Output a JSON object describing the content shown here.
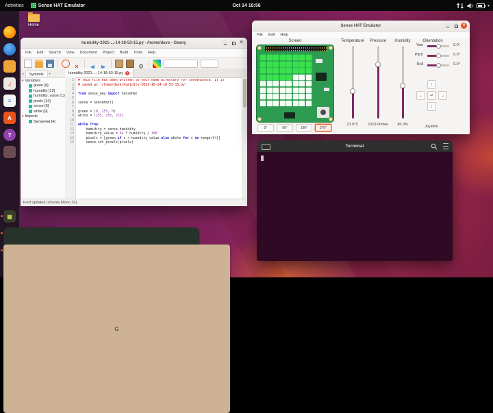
{
  "topbar": {
    "activities": "Activities",
    "focused_app": "Sense HAT Emulator",
    "clock": "Oct 14 18:56"
  },
  "desktop": {
    "home_label": "Home"
  },
  "dock": {
    "items": [
      {
        "id": "firefox",
        "color": ""
      },
      {
        "id": "thunderbird",
        "color": ""
      },
      {
        "id": "files",
        "color": "#f0a637"
      },
      {
        "id": "rhythmbox",
        "color": "#ece7e2",
        "glyph": "♫",
        "glyph_color": "#e9531f"
      },
      {
        "id": "libreoffice-writer",
        "color": "#f4f4f4",
        "glyph": "≡",
        "glyph_color": "#2a76c6"
      },
      {
        "id": "ubuntu-software",
        "color": "#e9531f",
        "glyph": "A",
        "glyph_color": "#ffffff"
      },
      {
        "id": "help",
        "color": "#9141ac",
        "glyph": "?",
        "glyph_color": "#ffffff"
      },
      {
        "id": "trash",
        "color": "#6b4a52"
      },
      {
        "id": "sense-hat-emulator",
        "color": "#3a3a2e",
        "glyph": "▦",
        "glyph_color": "#b8d44a",
        "running": true
      },
      {
        "id": "terminal",
        "color": "#26322a",
        "glyph": ">_",
        "glyph_color": "#58e36b",
        "running": true
      },
      {
        "id": "geany",
        "color": "#cdb295",
        "glyph": "G",
        "glyph_color": "#6b543a",
        "running": true
      }
    ]
  },
  "geany": {
    "title": "humidity-2021-...-14-18-53-15.py - /home/dave - Geany",
    "menu": [
      "File",
      "Edit",
      "Search",
      "View",
      "Document",
      "Project",
      "Build",
      "Tools",
      "Help"
    ],
    "toolbar_items": [
      "new",
      "open",
      "save",
      "sep",
      "revert",
      "close",
      "sep",
      "back",
      "forward",
      "sep",
      "compile",
      "build",
      "run",
      "sep",
      "color"
    ],
    "sidebar_tab": "Symbols",
    "symbols": [
      {
        "group": "Variables",
        "items": [
          "green [8]",
          "humidity [12]",
          "humidity_value [13]",
          "pixels [14]",
          "sense [6]",
          "white [9]"
        ]
      },
      {
        "group": "Imports",
        "items": [
          "SenseHat [4]"
        ]
      }
    ],
    "file_tab": "humidity-2021-...-14-18-53-15.py",
    "code": [
      "# This file has been written to your home directory for convenience. It is",
      "# saved as '/home/dave/humidity-2021-10-14-18-53-15.py'",
      "",
      "from sense_emu import SenseHat",
      "",
      "sense = SenseHat()",
      "",
      "green = (0, 255, 0)",
      "white = (255, 255, 255)",
      "",
      "while True:",
      "    humidity = sense.humidity",
      "    humidity_value = 64 * humidity / 100",
      "    pixels = [green if i < humidity_value else white for i in range(64)]",
      "    sense.set_pixels(pixels)"
    ],
    "status": "Font updated (Ubuntu Mono 10)."
  },
  "sensehat": {
    "title": "Sense HAT Emulator",
    "menu": [
      "File",
      "Edit",
      "Help"
    ],
    "columns": [
      "Screen",
      "Temperature",
      "Pressure",
      "Humidity",
      "Orientation"
    ],
    "sensors": [
      {
        "name": "temperature",
        "value": "21.0°C",
        "fraction": 0.38
      },
      {
        "name": "pressure",
        "value": "1013.0mbar",
        "fraction": 0.75
      },
      {
        "name": "humidity",
        "value": "45.0%",
        "fraction": 0.45
      }
    ],
    "orientation": [
      {
        "label": "Yaw",
        "value": "0.0°",
        "fraction": 0.5
      },
      {
        "label": "Pitch",
        "value": "0.0°",
        "fraction": 0.5
      },
      {
        "label": "Roll",
        "value": "0.0°",
        "fraction": 0.5
      }
    ],
    "rotation_buttons": [
      "0°",
      "90°",
      "180°",
      "270°"
    ],
    "rotation_selected": 3,
    "joystick_label": "Joystick",
    "joystick_buttons": [
      "↑",
      "←",
      "↵",
      "→",
      "↓"
    ],
    "led_matrix": {
      "rows": 8,
      "cols": 8,
      "green_count": 29,
      "green_color": "#39e24d",
      "white_color": "#f2fdf2"
    }
  },
  "terminal": {
    "title": "Terminal"
  }
}
